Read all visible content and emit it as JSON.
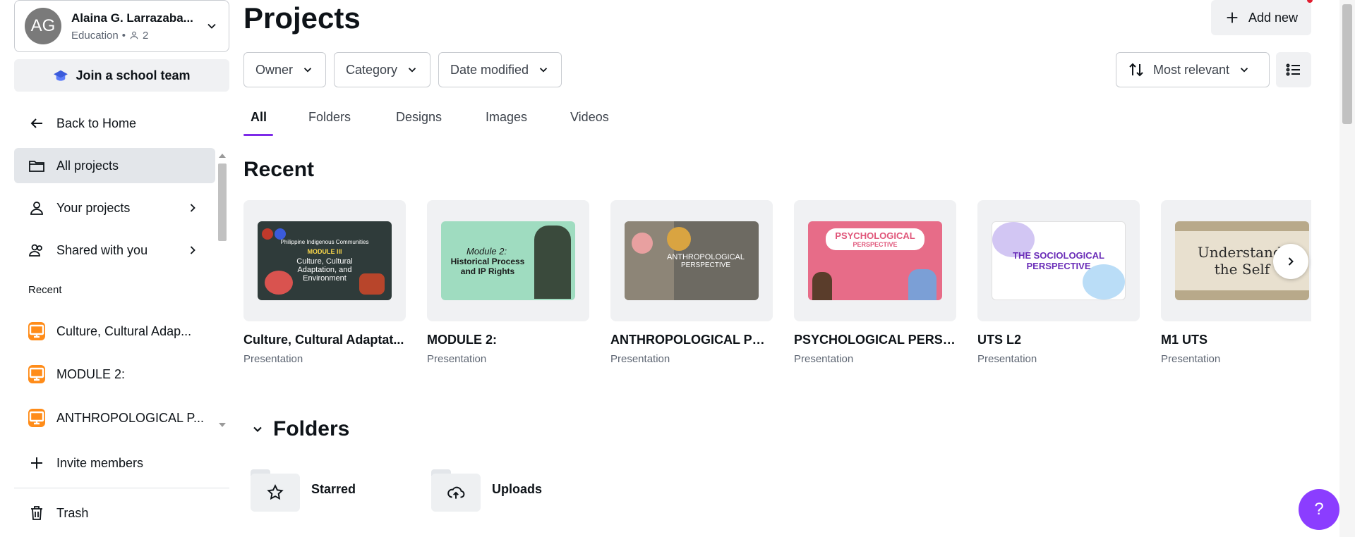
{
  "account": {
    "initials": "AG",
    "name": "Alaina G. Larrazaba...",
    "plan": "Education",
    "member_count": "2"
  },
  "sidebar": {
    "join_team": "Join a school team",
    "back_home": "Back to Home",
    "items": [
      {
        "label": "All projects"
      },
      {
        "label": "Your projects"
      },
      {
        "label": "Shared with you"
      }
    ],
    "recent_heading": "Recent",
    "recent": [
      {
        "label": "Culture, Cultural Adap..."
      },
      {
        "label": "MODULE 2:"
      },
      {
        "label": "ANTHROPOLOGICAL P..."
      }
    ],
    "invite": "Invite members",
    "trash": "Trash"
  },
  "header": {
    "title": "Projects",
    "add_new": "Add new"
  },
  "filters": {
    "owner": "Owner",
    "category": "Category",
    "date_modified": "Date modified",
    "sort": "Most relevant"
  },
  "tabs": [
    "All",
    "Folders",
    "Designs",
    "Images",
    "Videos"
  ],
  "recent": {
    "title": "Recent",
    "cards": [
      {
        "name": "Culture, Cultural Adaptat...",
        "type": "Presentation",
        "thumb_line1": "Philippine Indigenous Communities",
        "thumb_line2": "MODULE III",
        "thumb_line3": "Culture, Cultural Adaptation, and Environment"
      },
      {
        "name": "MODULE 2:",
        "type": "Presentation",
        "thumb_line1": "Module 2:",
        "thumb_line2": "Historical Process and IP Rights"
      },
      {
        "name": "ANTHROPOLOGICAL PER...",
        "type": "Presentation",
        "thumb_line1": "ANTHROPOLOGICAL",
        "thumb_line2": "PERSPECTIVE"
      },
      {
        "name": "PSYCHOLOGICAL PERSP...",
        "type": "Presentation",
        "thumb_line1": "PSYCHOLOGICAL",
        "thumb_line2": "PERSPECTIVE"
      },
      {
        "name": "UTS L2",
        "type": "Presentation",
        "thumb_line1": "THE SOCIOLOGICAL",
        "thumb_line2": "PERSPECTIVE"
      },
      {
        "name": "M1 UTS",
        "type": "Presentation",
        "thumb_line1": "Understandi",
        "thumb_line2": "the Self"
      }
    ]
  },
  "folders": {
    "title": "Folders",
    "items": [
      {
        "label": "Starred"
      },
      {
        "label": "Uploads"
      }
    ]
  },
  "help": {
    "label": "?"
  },
  "colors": {
    "accent": "#7d2ae8",
    "help_bg": "#8b3dff",
    "recent_icon": "#ff8c19"
  }
}
